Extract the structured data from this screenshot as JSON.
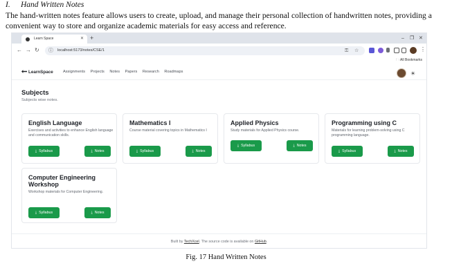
{
  "doc": {
    "section_number": "I.",
    "section_title": "Hand Written Notes",
    "paragraph": "The hand-written notes feature allows users to create, upload, and manage their personal collection of handwritten notes, providing a convenient way to store and organize academic materials for easy access and reference.",
    "caption": "Fig. 17 Hand Written Notes"
  },
  "browser": {
    "tab_title": "Learn Space",
    "url": "localhost:5173/notes/CSE/1",
    "bookmarks_label": "All Bookmarks",
    "icons": [
      "back-icon",
      "forward-icon",
      "reload-icon",
      "info-icon",
      "key-icon",
      "star-icon",
      "extension-icon",
      "sidebar-icon",
      "minimize-icon",
      "maximize-icon",
      "close-icon"
    ]
  },
  "app": {
    "brand": "LearnSpace",
    "nav": [
      "Assignments",
      "Projects",
      "Notes",
      "Papers",
      "Research",
      "Roadmaps"
    ],
    "page_title": "Subjects",
    "page_subtitle": "Subjects wise notes.",
    "syllabus_label": "Syllabus",
    "notes_label": "Notes",
    "accent_color": "#1a9a4a",
    "subjects": [
      {
        "title": "English Language",
        "description": "Exercises and activities to enhance English language and communication skills."
      },
      {
        "title": "Mathematics I",
        "description": "Course material covering topics in Mathematics I"
      },
      {
        "title": "Applied Physics",
        "description": "Study materials for Applied Physics course."
      },
      {
        "title": "Programming using C",
        "description": "Materials for learning problem-solving using C programming language."
      },
      {
        "title": "Computer Engineering Workshop",
        "description": "Workshop materials for Computer Engineering."
      }
    ],
    "footer": {
      "prefix": "Built by ",
      "author": "TechXcel",
      "middle": ". The source code is available on ",
      "link": "GitHub",
      "suffix": "."
    }
  }
}
